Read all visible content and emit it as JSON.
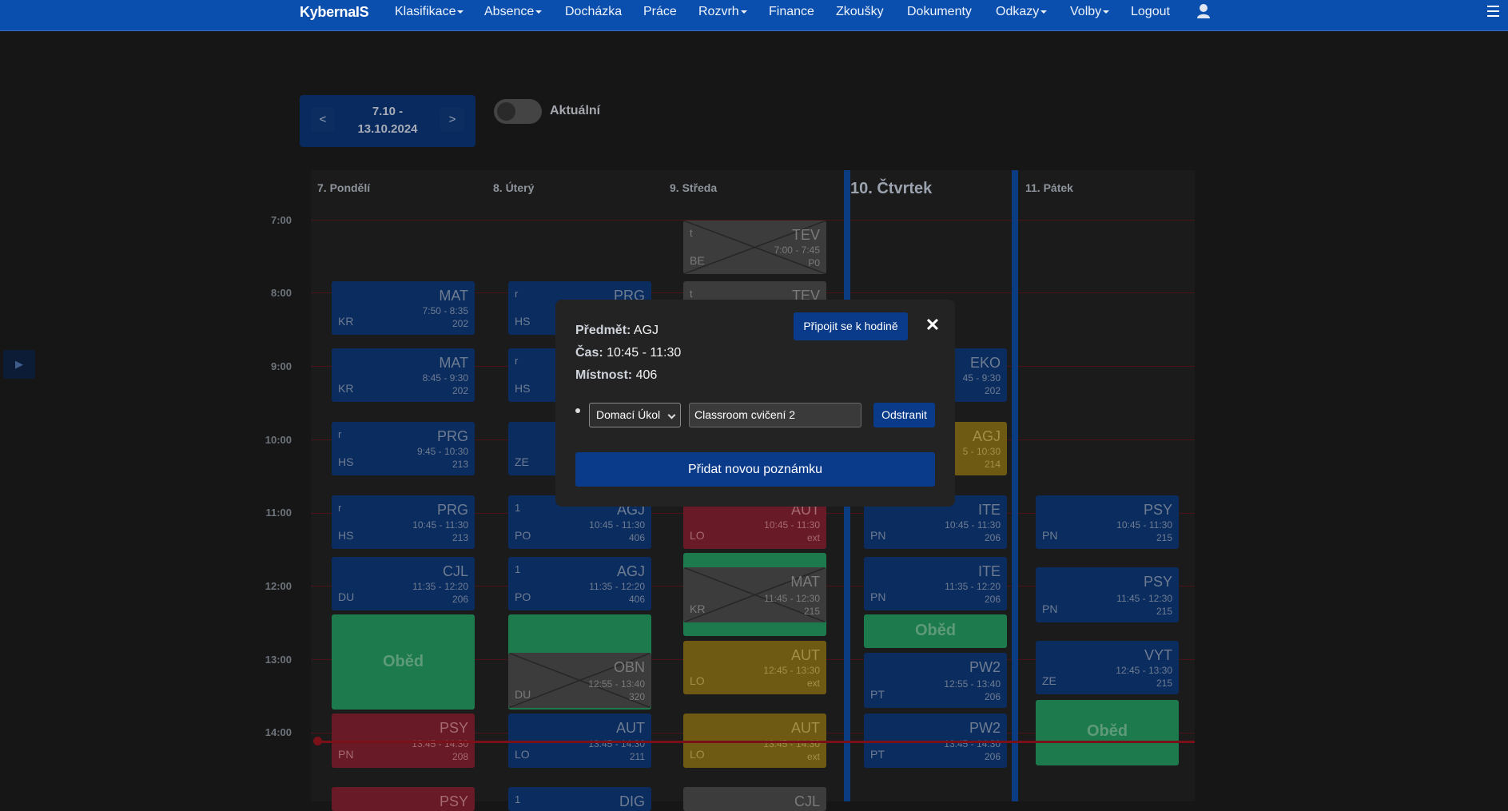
{
  "nav": {
    "brand": "KybernaIS",
    "items": [
      {
        "label": "Klasifikace",
        "dropdown": true
      },
      {
        "label": "Absence",
        "dropdown": true
      },
      {
        "label": "Docházka",
        "dropdown": false
      },
      {
        "label": "Práce",
        "dropdown": false
      },
      {
        "label": "Rozvrh",
        "dropdown": true
      },
      {
        "label": "Finance",
        "dropdown": false
      },
      {
        "label": "Zkoušky",
        "dropdown": false
      },
      {
        "label": "Dokumenty",
        "dropdown": false
      },
      {
        "label": "Odkazy",
        "dropdown": true
      },
      {
        "label": "Volby",
        "dropdown": true
      },
      {
        "label": "Logout",
        "dropdown": false
      }
    ],
    "user_icon": "user-icon",
    "menu_icon": "hamburger-icon"
  },
  "week": {
    "prev": "<",
    "next": ">",
    "range_line1": "7.10 -",
    "range_line2": "13.10.2024"
  },
  "toggle": {
    "label": "Aktuální",
    "on": false
  },
  "timetable": {
    "days": [
      "7. Pondělí",
      "8. Úterý",
      "9. Středa",
      "10. Čtvrtek",
      "11. Pátek"
    ],
    "times": [
      "7:00",
      "8:00",
      "9:00",
      "10:00",
      "11:00",
      "12:00",
      "13:00",
      "14:00"
    ],
    "lunch_label": "Oběd",
    "lessons": {
      "mon": [
        {
          "subject": "MAT",
          "teacher": "KR",
          "time": "7:50 - 8:35",
          "room": "202",
          "tl": ""
        },
        {
          "subject": "MAT",
          "teacher": "KR",
          "time": "8:45 - 9:30",
          "room": "202",
          "tl": ""
        },
        {
          "subject": "PRG",
          "teacher": "HS",
          "time": "9:45 - 10:30",
          "room": "213",
          "tl": "r"
        },
        {
          "subject": "PRG",
          "teacher": "HS",
          "time": "10:45 - 11:30",
          "room": "213",
          "tl": "r"
        },
        {
          "subject": "CJL",
          "teacher": "DU",
          "time": "11:35 - 12:20",
          "room": "206",
          "tl": ""
        },
        {
          "subject": "PSY",
          "teacher": "PN",
          "time": "13:45 - 14:30",
          "room": "208",
          "tl": ""
        },
        {
          "subject": "PSY",
          "teacher": "",
          "time": "",
          "room": "",
          "tl": ""
        }
      ],
      "tue": [
        {
          "subject": "PRG",
          "teacher": "HS",
          "time": "",
          "room": "",
          "tl": "r"
        },
        {
          "subject": "",
          "teacher": "HS",
          "time": "",
          "room": "",
          "tl": "r"
        },
        {
          "subject": "",
          "teacher": "ZE",
          "time": "",
          "room": "",
          "tl": ""
        },
        {
          "subject": "AGJ",
          "teacher": "PO",
          "time": "10:45 - 11:30",
          "room": "406",
          "tl": "1"
        },
        {
          "subject": "AGJ",
          "teacher": "PO",
          "time": "11:35 - 12:20",
          "room": "406",
          "tl": "1"
        },
        {
          "subject": "OBN",
          "teacher": "DU",
          "time": "12:55 - 13:40",
          "room": "320",
          "tl": ""
        },
        {
          "subject": "AUT",
          "teacher": "LO",
          "time": "13:45 - 14:30",
          "room": "211",
          "tl": ""
        },
        {
          "subject": "DIG",
          "teacher": "",
          "time": "",
          "room": "",
          "tl": "1"
        }
      ],
      "wed": [
        {
          "subject": "TEV",
          "teacher": "BE",
          "time": "7:00 - 7:45",
          "room": "P0",
          "tl": "t"
        },
        {
          "subject": "TEV",
          "teacher": "",
          "time": "",
          "room": "",
          "tl": "t"
        },
        {
          "subject": "AUT",
          "teacher": "LO",
          "time": "10:45 - 11:30",
          "room": "ext",
          "tl": ""
        },
        {
          "subject": "MAT",
          "teacher": "KR",
          "time": "11:45 - 12:30",
          "room": "215",
          "tl": ""
        },
        {
          "subject": "AUT",
          "teacher": "LO",
          "time": "12:45 - 13:30",
          "room": "ext",
          "tl": ""
        },
        {
          "subject": "AUT",
          "teacher": "LO",
          "time": "13:45 - 14:30",
          "room": "ext",
          "tl": ""
        },
        {
          "subject": "CJL",
          "teacher": "",
          "time": "",
          "room": "",
          "tl": ""
        }
      ],
      "thu": [
        {
          "subject": "EKO",
          "teacher": "",
          "time": "45 - 9:30",
          "room": "202",
          "tl": ""
        },
        {
          "subject": "AGJ",
          "teacher": "",
          "time": "5 - 10:30",
          "room": "214",
          "tl": ""
        },
        {
          "subject": "ITE",
          "teacher": "PN",
          "time": "10:45 - 11:30",
          "room": "206",
          "tl": ""
        },
        {
          "subject": "ITE",
          "teacher": "PN",
          "time": "11:35 - 12:20",
          "room": "206",
          "tl": ""
        },
        {
          "subject": "PW2",
          "teacher": "PT",
          "time": "12:55 - 13:40",
          "room": "206",
          "tl": ""
        },
        {
          "subject": "PW2",
          "teacher": "PT",
          "time": "13:45 - 14:30",
          "room": "206",
          "tl": ""
        }
      ],
      "fri": [
        {
          "subject": "PSY",
          "teacher": "PN",
          "time": "10:45 - 11:30",
          "room": "215",
          "tl": ""
        },
        {
          "subject": "PSY",
          "teacher": "PN",
          "time": "11:45 - 12:30",
          "room": "215",
          "tl": ""
        },
        {
          "subject": "VYT",
          "teacher": "ZE",
          "time": "12:45 - 13:30",
          "room": "215",
          "tl": ""
        }
      ]
    }
  },
  "side_button": "▶",
  "modal": {
    "subject_label": "Předmět:",
    "subject_value": "AGJ",
    "time_label": "Čas:",
    "time_value": "10:45 - 11:30",
    "room_label": "Místnost:",
    "room_value": "406",
    "join_label": "Připojit se k hodině",
    "close_label": "✕",
    "note_type": "Domací Úkol",
    "note_text": "Classroom cvičení 2",
    "remove_label": "Odstranit",
    "add_label": "Přidat novou poznámku"
  },
  "colors": {
    "navbar": "#0a4fae",
    "lesson_blue": "#0b2c5e",
    "lesson_red": "#681a26",
    "lesson_green": "#1c7a4c",
    "lesson_yellow": "#6e5a12",
    "lesson_gray": "#3c3c3c",
    "button": "#0a3a8a"
  }
}
